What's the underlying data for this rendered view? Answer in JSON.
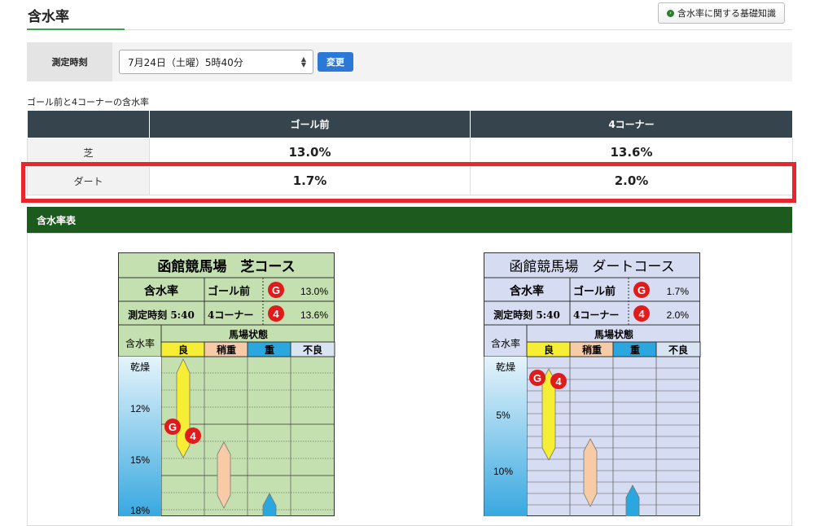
{
  "header": {
    "title": "含水率",
    "basic_button": "含水率に関する基礎知識"
  },
  "filter": {
    "label": "測定時刻",
    "selected": "7月24日（土曜）5時40分",
    "change_button": "変更"
  },
  "caption": "ゴール前と4コーナーの含水率",
  "table": {
    "headers": [
      "",
      "ゴール前",
      "4コーナー"
    ],
    "rows": [
      {
        "label": "芝",
        "goal": "13.0%",
        "corner": "13.6%"
      },
      {
        "label": "ダート",
        "goal": "1.7%",
        "corner": "2.0%"
      }
    ]
  },
  "section_title": "含水率表",
  "charts": [
    {
      "title": "函館競馬場　芝コース",
      "moisture_label": "含水率",
      "time_label": "測定時刻 5:40",
      "goal_label": "ゴール前",
      "goal_value": "13.0%",
      "corner_label": "4コーナー",
      "corner_value": "13.6%",
      "moisture_col_label": "含水率",
      "state_label": "馬場状態",
      "states": [
        "良",
        "稍重",
        "重",
        "不良"
      ],
      "dry_label": "乾燥",
      "ticks": [
        "12%",
        "15%",
        "18%"
      ],
      "marker_g": "G",
      "marker_4": "4"
    },
    {
      "title": "函館競馬場　ダートコース",
      "moisture_label": "含水率",
      "time_label": "測定時刻 5:40",
      "goal_label": "ゴール前",
      "goal_value": "1.7%",
      "corner_label": "4コーナー",
      "corner_value": "2.0%",
      "moisture_col_label": "含水率",
      "state_label": "馬場状態",
      "states": [
        "良",
        "稍重",
        "重",
        "不良"
      ],
      "dry_label": "乾燥",
      "ticks": [
        "5%",
        "10%"
      ],
      "marker_g": "G",
      "marker_4": "4"
    }
  ]
}
